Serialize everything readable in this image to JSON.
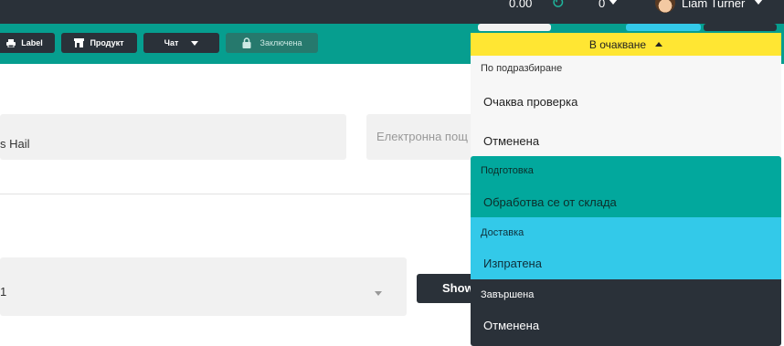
{
  "topbar": {
    "balance": "0.00",
    "refresh_icon": "refresh-icon",
    "count": "0",
    "user_name": "Liam Turner"
  },
  "toolbar": {
    "buttons": [
      {
        "label": "Label",
        "icon": "printer-icon"
      },
      {
        "label": "Продукт",
        "icon": "store-icon"
      },
      {
        "label": "Чат",
        "icon": "chevron-down-icon"
      },
      {
        "label": "Заключена",
        "icon": "lock-icon"
      }
    ]
  },
  "form": {
    "name_value": "s Hail",
    "email_placeholder": "Електронна пощ",
    "select_value": "1",
    "show_button": "Show"
  },
  "status": {
    "current": "В очакване",
    "groups": [
      {
        "header": "По подразбиране",
        "options": [
          "Очаква проверка",
          "Отменена"
        ]
      },
      {
        "header": "Подготовка",
        "options": [
          "Обработва се от склада"
        ]
      },
      {
        "header": "Доставка",
        "options": [
          "Изпратена"
        ]
      },
      {
        "header": "Завършена",
        "options": [
          "Отменена"
        ]
      }
    ]
  },
  "colors": {
    "topbar": "#2a3139",
    "toolbar": "#069e8f",
    "status_yellow": "#ffe633",
    "group_preparation": "#02a89d",
    "group_delivery": "#33c9e9",
    "group_completed": "#2a3139"
  }
}
